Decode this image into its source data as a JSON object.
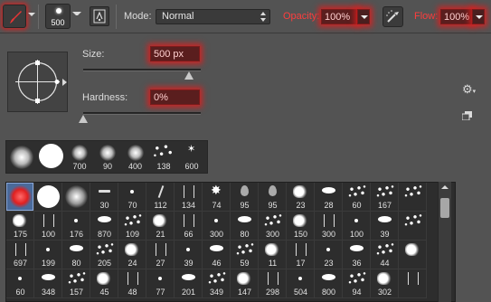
{
  "options_bar": {
    "brush_size_preview": "500",
    "mode_label": "Mode:",
    "mode_value": "Normal",
    "opacity_label": "Opacity:",
    "opacity_value": "100%",
    "flow_label": "Flow:",
    "flow_value": "100%",
    "icons": [
      "brush-tool-icon",
      "brush-panel-icon",
      "airbrush-icon"
    ],
    "highlight_color": "#e02020"
  },
  "brush_settings": {
    "size_label": "Size:",
    "size_value": "500 px",
    "size_fraction": 1.0,
    "hardness_label": "Hardness:",
    "hardness_value": "0%",
    "hardness_fraction": 0.0
  },
  "recent_brushes": [
    {
      "label": "",
      "type": "soft"
    },
    {
      "label": "",
      "type": "hard"
    },
    {
      "label": "700",
      "type": "soft"
    },
    {
      "label": "90",
      "type": "soft"
    },
    {
      "label": "400",
      "type": "soft"
    },
    {
      "label": "138",
      "type": "scatter"
    },
    {
      "label": "600",
      "type": "star"
    }
  ],
  "brush_grid": [
    [
      "",
      "",
      "",
      "30",
      "70",
      "112",
      "134",
      "74",
      "95",
      "95",
      "23",
      "28",
      "60",
      "167",
      ""
    ],
    [
      "175",
      "100",
      "176",
      "870",
      "109",
      "21",
      "66",
      "300",
      "80",
      "300",
      "150",
      "300",
      "100",
      "39",
      ""
    ],
    [
      "697",
      "199",
      "80",
      "205",
      "24",
      "27",
      "39",
      "46",
      "59",
      "11",
      "17",
      "23",
      "36",
      "44",
      ""
    ],
    [
      "60",
      "348",
      "157",
      "45",
      "48",
      "77",
      "201",
      "349",
      "147",
      "298",
      "504",
      "800",
      "94",
      "302",
      ""
    ]
  ]
}
